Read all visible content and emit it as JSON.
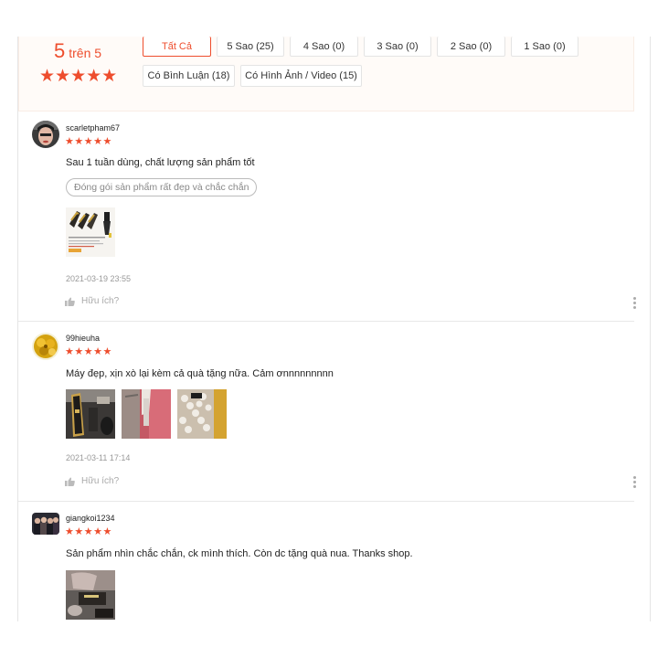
{
  "overview": {
    "score": "5",
    "score_suffix": "trên 5",
    "stars": "★★★★★",
    "filters": [
      {
        "label": "Tất Cả",
        "active": true
      },
      {
        "label": "5 Sao (25)",
        "active": false
      },
      {
        "label": "4 Sao (0)",
        "active": false
      },
      {
        "label": "3 Sao (0)",
        "active": false
      },
      {
        "label": "2 Sao (0)",
        "active": false
      },
      {
        "label": "1 Sao (0)",
        "active": false
      },
      {
        "label": "Có Bình Luận (18)",
        "active": false
      },
      {
        "label": "Có Hình Ảnh / Video (15)",
        "active": false
      }
    ]
  },
  "reviews": [
    {
      "username": "scarletpham67",
      "rating": 5,
      "stars": "★★★★★",
      "comment": "Sau 1 tuần dùng, chất lượng sản phẩm tốt",
      "tag": "Đóng gói sản phẩm rất đẹp và chắc chắn",
      "timestamp": "2021-03-19 23:55",
      "helpful_label": "Hữu ích?"
    },
    {
      "username": "99hieuha",
      "rating": 5,
      "stars": "★★★★★",
      "comment": "Máy đẹp, xịn xò lại kèm cả quà tặng nữa. Cảm ơnnnnnnnnn",
      "timestamp": "2021-03-11 17:14",
      "helpful_label": "Hữu ích?"
    },
    {
      "username": "giangkoi1234",
      "rating": 5,
      "stars": "★★★★★",
      "comment": "Sản phẩm nhìn chắc chắn, ck mình thích. Còn dc tặng quà nua. Thanks shop."
    }
  ],
  "colors": {
    "accent": "#ee4d2d",
    "overview_bg": "#fffbf8",
    "muted_text": "#999999"
  },
  "icons": {
    "helpful": "thumbs-up-icon",
    "more": "more-vertical-icon"
  }
}
